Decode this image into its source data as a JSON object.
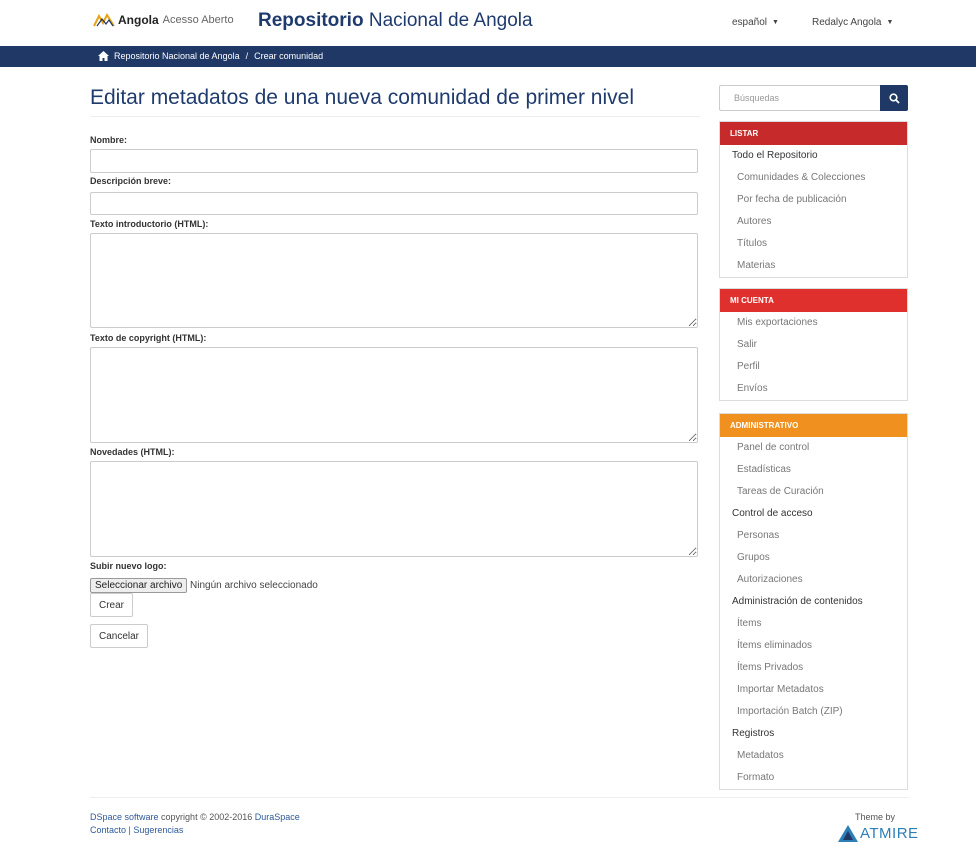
{
  "header": {
    "brand_name": "Angola",
    "brand_sub": "Acesso Aberto",
    "title_bold": "Repositorio",
    "title_rest": " Nacional de Angola",
    "language": "español",
    "user": "Redalyc Angola"
  },
  "breadcrumb": {
    "home": "Repositorio Nacional de Angola",
    "separator": "/",
    "current": "Crear comunidad"
  },
  "page": {
    "title": "Editar metadatos de una nueva comunidad de primer nivel"
  },
  "form": {
    "name_label": "Nombre:",
    "name_value": "",
    "short_desc_label": "Descripción breve:",
    "short_desc_value": "",
    "intro_label": "Texto introductorio (HTML):",
    "intro_value": "",
    "copyright_label": "Texto de copyright (HTML):",
    "copyright_value": "",
    "news_label": "Novedades (HTML):",
    "news_value": "",
    "logo_label": "Subir nuevo logo:",
    "file_button": "Seleccionar archivo",
    "file_status": "Ningún archivo seleccionado",
    "create_button": "Crear",
    "cancel_button": "Cancelar"
  },
  "sidebar": {
    "search_placeholder": "Búsquedas",
    "browse": {
      "heading": "LISTAR",
      "color": "#c62a2a",
      "items": [
        "Todo el Repositorio",
        "Comunidades & Colecciones",
        "Por fecha de publicación",
        "Autores",
        "Títulos",
        "Materias"
      ]
    },
    "account": {
      "heading": "MI CUENTA",
      "color": "#e0302e",
      "items": [
        "Mis exportaciones",
        "Salir",
        "Perfil",
        "Envíos"
      ]
    },
    "admin": {
      "heading": "ADMINISTRATIVO",
      "color": "#f0901e",
      "items": [
        "Panel de control",
        "Estadísticas",
        "Tareas de Curación",
        "Control de acceso",
        "Personas",
        "Grupos",
        "Autorizaciones",
        "Administración de contenidos",
        "Ítems",
        "Ítems eliminados",
        "Ítems Privados",
        "Importar Metadatos",
        "Importación Batch (ZIP)",
        "Registros",
        "Metadatos",
        "Formato"
      ]
    }
  },
  "footer": {
    "copyright_link": "DSpace software",
    "copyright_text": " copyright © 2002-2016 ",
    "duraspace": "DuraSpace",
    "contact": "Contacto",
    "divider": " | ",
    "feedback": "Sugerencias",
    "theme_by": "Theme by",
    "atmire": "ATMIRE"
  },
  "colors": {
    "navy": "#1f3866",
    "title_blue": "#1f3b6e"
  }
}
